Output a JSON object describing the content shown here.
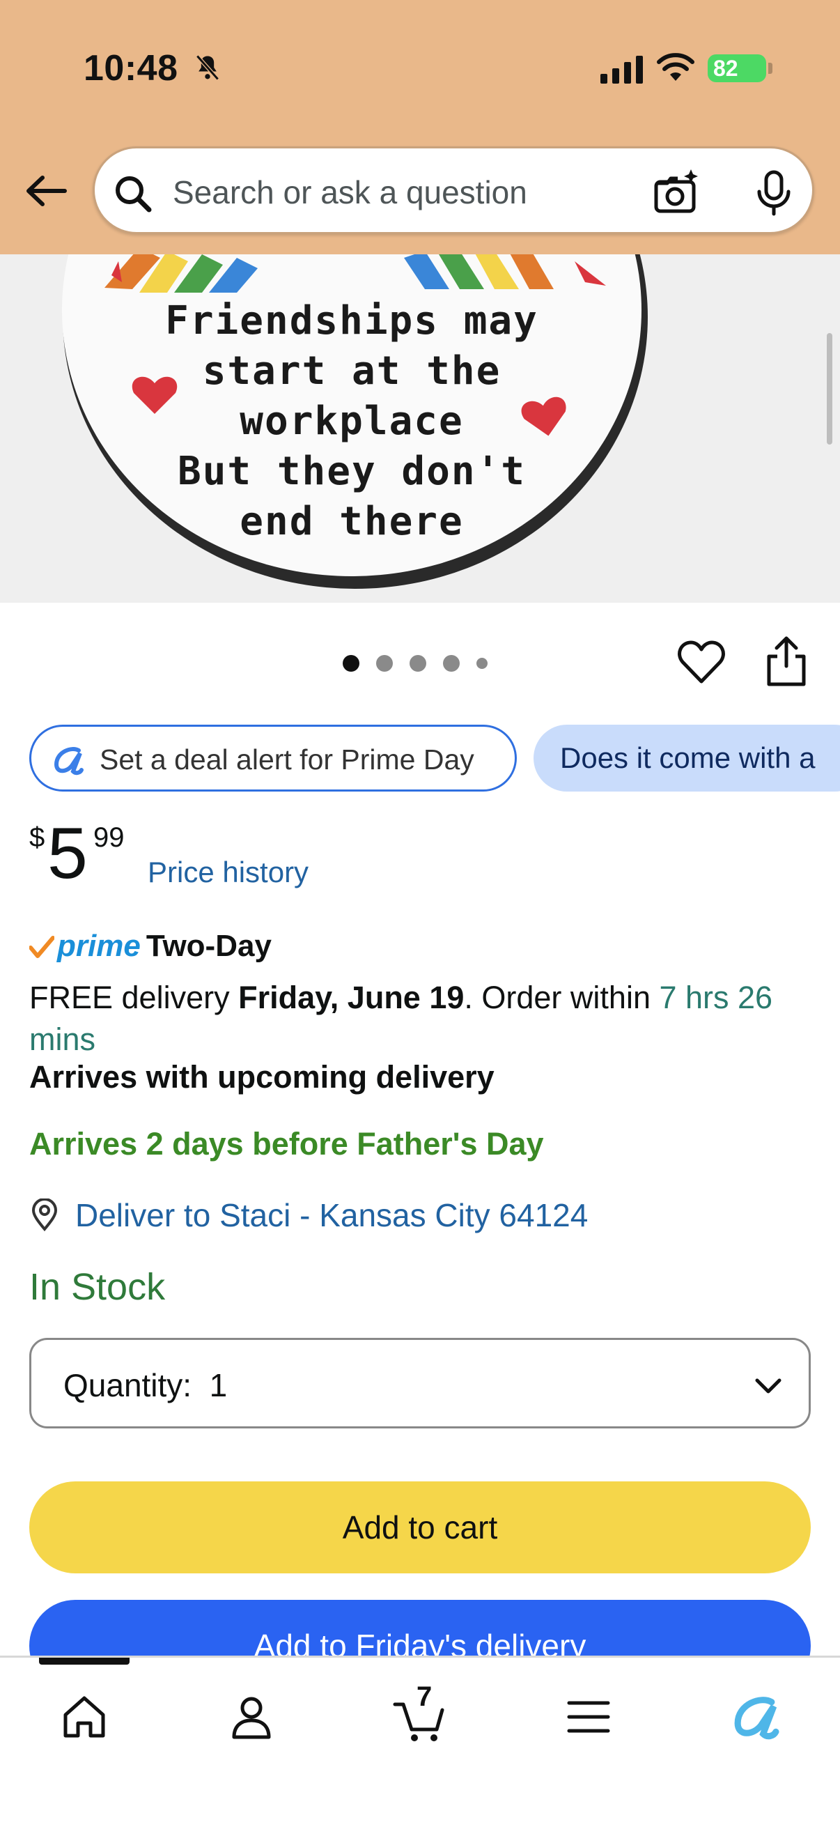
{
  "status_bar": {
    "time": "10:48",
    "battery": "82"
  },
  "search": {
    "placeholder": "Search or ask a question"
  },
  "product_image": {
    "text_lines": [
      "Friendships may",
      "start at the",
      "workplace",
      "But they don't",
      "end there"
    ]
  },
  "chips": {
    "deal_alert": "Set a deal alert for Prime Day",
    "question": "Does it come with a"
  },
  "price": {
    "currency": "$",
    "whole": "5",
    "fraction": "99",
    "history_link": "Price history"
  },
  "delivery": {
    "prime_label": "prime",
    "two_day": "Two-Day",
    "free_delivery_prefix": "FREE delivery ",
    "delivery_date": "Friday, June 19",
    "order_within_prefix": ". Order within ",
    "order_within_time": "7 hrs 26 mins",
    "arrives_upcoming": "Arrives with upcoming delivery",
    "fathers_day": "Arrives 2 days before Father's Day",
    "deliver_to": "Deliver to Staci - Kansas City 64124",
    "stock": "In Stock"
  },
  "quantity": {
    "label": "Quantity:",
    "value": "1"
  },
  "buttons": {
    "add_to_cart": "Add to cart",
    "add_to_friday": "Add to Friday's delivery"
  },
  "nav": {
    "cart_count": "7"
  },
  "colors": {
    "header_bg": "#e9b88a",
    "add_to_cart": "#f5d64a",
    "add_to_friday": "#2a63f2",
    "link": "#2162a1",
    "in_stock": "#2f7a3a"
  }
}
